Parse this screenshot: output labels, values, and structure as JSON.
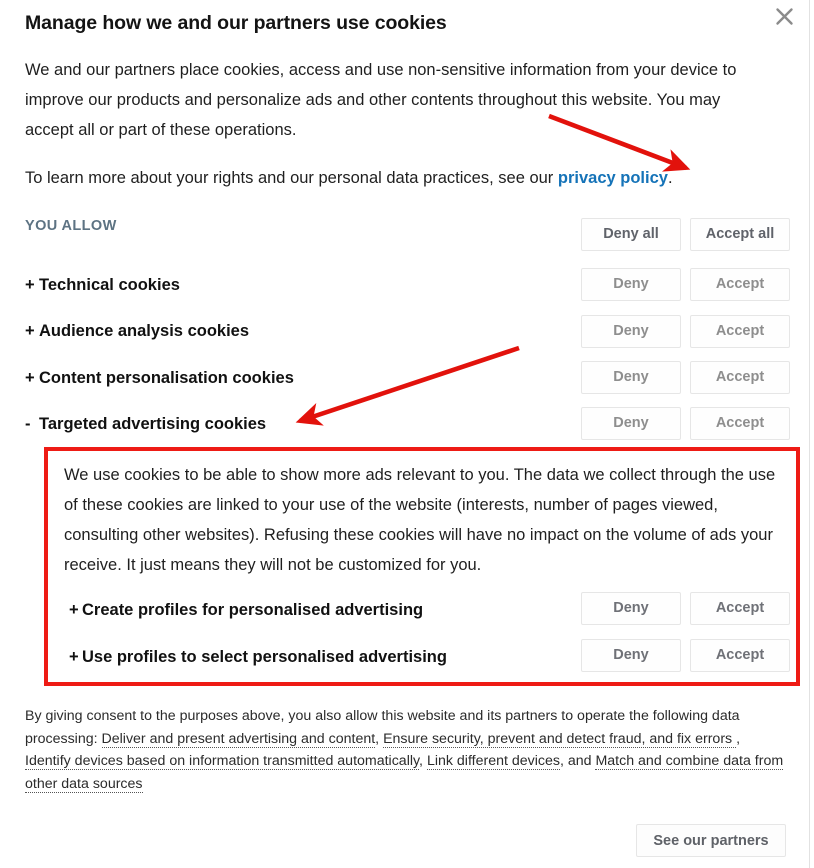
{
  "dialog": {
    "title": "Manage how we and our partners use cookies",
    "close_icon": "close-icon",
    "intro_paragraph_1": "We and our partners place cookies, access and use non-sensitive information from your device to improve our products and personalize ads and other contents throughout this website. You may accept all or part of these operations.",
    "intro_paragraph_2_prefix": "To learn more about your rights and our personal data practices, see our ",
    "privacy_policy_link": "privacy policy",
    "intro_paragraph_2_suffix": "."
  },
  "allow_section": {
    "label": "YOU ALLOW",
    "deny_all_label": "Deny all",
    "accept_all_label": "Accept all",
    "deny_label": "Deny",
    "accept_label": "Accept",
    "categories": [
      {
        "sign": "+",
        "label": "Technical cookies",
        "expanded": false
      },
      {
        "sign": "+",
        "label": "Audience analysis cookies",
        "expanded": false
      },
      {
        "sign": "+",
        "label": "Content personalisation cookies",
        "expanded": false
      },
      {
        "sign": "-",
        "label": "Targeted advertising cookies",
        "expanded": true
      }
    ]
  },
  "expanded_detail": {
    "description": "We use cookies to be able to show more ads relevant to you. The data we collect through the use of these cookies are linked to your use of the website (interests, number of pages viewed, consulting other websites). Refusing these cookies will have no impact on the volume of ads your receive. It just means they will not be customized for you.",
    "sub_items": [
      {
        "sign": "+",
        "label": "Create profiles for personalised advertising"
      },
      {
        "sign": "+",
        "label": "Use profiles to select personalised advertising"
      }
    ]
  },
  "consent_footer": {
    "lead": "By giving consent to the purposes above, you also allow this website and its partners to operate the following data processing: ",
    "links": [
      "Deliver and present advertising and content",
      "Ensure security, prevent and detect fraud, and fix errors ",
      "Identify devices based on information transmitted automatically",
      "Link different devices",
      "Match and combine data from other data sources"
    ],
    "sep_1": ", ",
    "sep_2": ", ",
    "sep_3": ", ",
    "sep_4": ", and "
  },
  "footer": {
    "partners_label": "See our partners"
  },
  "annotations": {
    "arrow_color": "#e2120c",
    "box_color": "#ee1b15",
    "arrow_1_name": "arrow-to-privacy-policy",
    "arrow_2_name": "arrow-to-targeted-advertising-cookies",
    "box_name": "highlight-box-targeted-advertising-detail"
  },
  "colors": {
    "link_blue": "#1573b8",
    "allow_label": "#5d7383",
    "button_text": "#8e8e8e",
    "annotation_red": "#ee1b15"
  }
}
